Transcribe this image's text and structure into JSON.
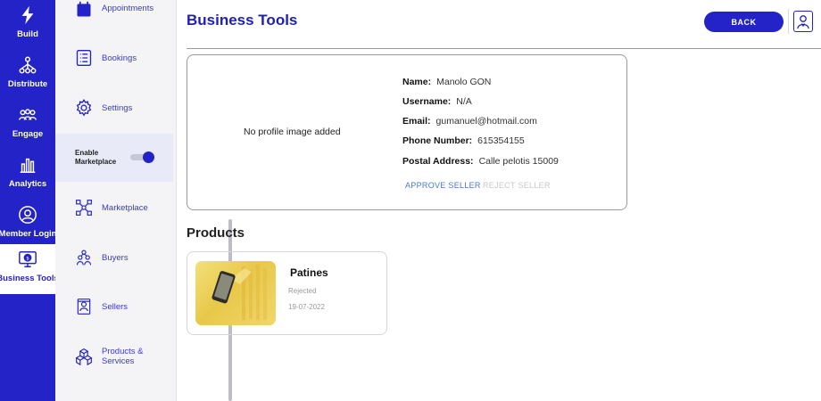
{
  "rail": {
    "items": [
      {
        "label": "Build",
        "icon": "lightning-icon"
      },
      {
        "label": "Distribute",
        "icon": "network-icon"
      },
      {
        "label": "Engage",
        "icon": "users-icon"
      },
      {
        "label": "Analytics",
        "icon": "bar-chart-icon"
      },
      {
        "label": "Member Login",
        "icon": "user-circle-icon"
      },
      {
        "label": "Business Tools",
        "icon": "dollar-monitor-icon"
      }
    ],
    "active": "Business Tools"
  },
  "subnav": {
    "items": [
      {
        "label": "Appointments",
        "icon": "calendar-icon"
      },
      {
        "label": "Bookings",
        "icon": "list-icon"
      },
      {
        "label": "Settings",
        "icon": "gear-icon"
      },
      {
        "label": "Marketplace",
        "icon": "marketplace-icon"
      },
      {
        "label": "Buyers",
        "icon": "buyers-icon"
      },
      {
        "label": "Sellers",
        "icon": "sellers-icon"
      },
      {
        "label": "Products & Services",
        "icon": "cubes-icon"
      }
    ],
    "enable_marketplace": {
      "label_line1": "Enable",
      "label_line2": "Marketplace",
      "enabled": true
    }
  },
  "header": {
    "title": "Business Tools",
    "back_label": "BACK"
  },
  "profile": {
    "no_image_text": "No profile image added",
    "fields": [
      {
        "label": "Name:",
        "value": "Manolo GON"
      },
      {
        "label": "Username:",
        "value": "N/A"
      },
      {
        "label": "Email:",
        "value": "gumanuel@hotmail.com"
      },
      {
        "label": "Phone Number:",
        "value": "615354155"
      },
      {
        "label": "Postal Address:",
        "value": "Calle pelotis 15009"
      }
    ],
    "approve_label": "APPROVE SELLER",
    "reject_label": "REJECT SELLER"
  },
  "products": {
    "heading": "Products",
    "items": [
      {
        "name": "Patines",
        "status": "Rejected",
        "date": "19-07-2022"
      }
    ]
  },
  "colors": {
    "brand": "#2323c8",
    "title": "#1f1fb4",
    "approve": "#4a78d0",
    "reject_disabled": "#c8c8cc"
  }
}
